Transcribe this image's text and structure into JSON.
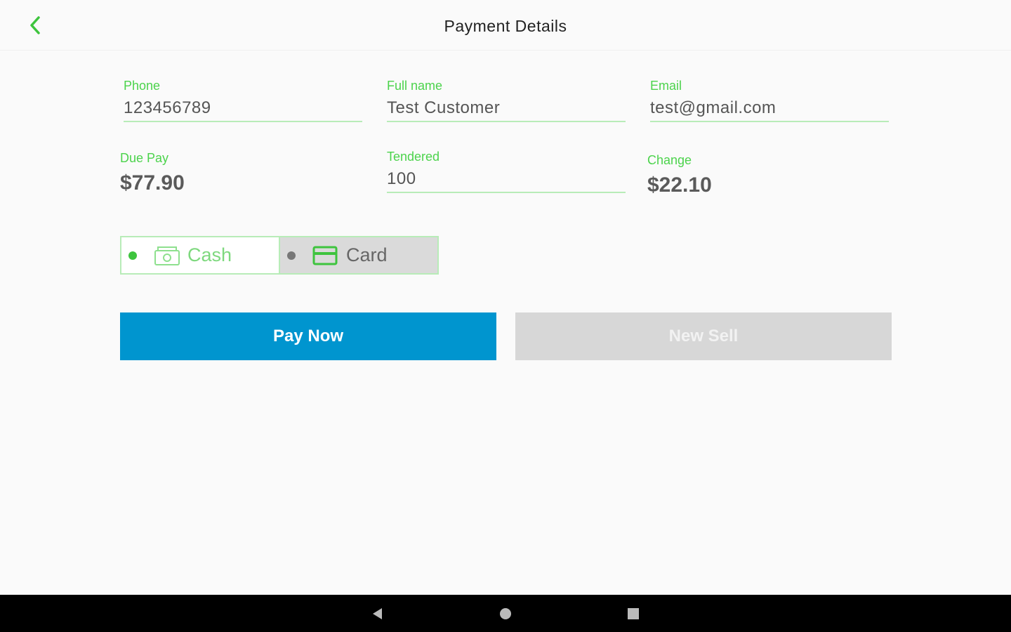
{
  "header": {
    "title": "Payment Details",
    "back_icon": "chevron-left-icon"
  },
  "customer": {
    "phone": {
      "label": "Phone",
      "value": "123456789"
    },
    "full_name": {
      "label": "Full name",
      "value": "Test Customer"
    },
    "email": {
      "label": "Email",
      "value": "test@gmail.com"
    }
  },
  "payment": {
    "due_pay": {
      "label": "Due Pay",
      "value": "$77.90"
    },
    "tendered": {
      "label": "Tendered",
      "value": "100"
    },
    "change": {
      "label": "Change",
      "value": "$22.10"
    }
  },
  "method": {
    "options": [
      {
        "label": "Cash",
        "icon": "cash-icon",
        "selected": true
      },
      {
        "label": "Card",
        "icon": "card-icon",
        "selected": false
      }
    ]
  },
  "actions": {
    "pay_now": "Pay Now",
    "new_sell": "New Sell"
  },
  "system_nav": {
    "back": "nav-back-icon",
    "home": "nav-home-icon",
    "recents": "nav-recents-icon"
  },
  "colors": {
    "accent_green": "#4cd34c",
    "primary_blue": "#0095cf",
    "disabled_gray": "#d7d7d7"
  }
}
